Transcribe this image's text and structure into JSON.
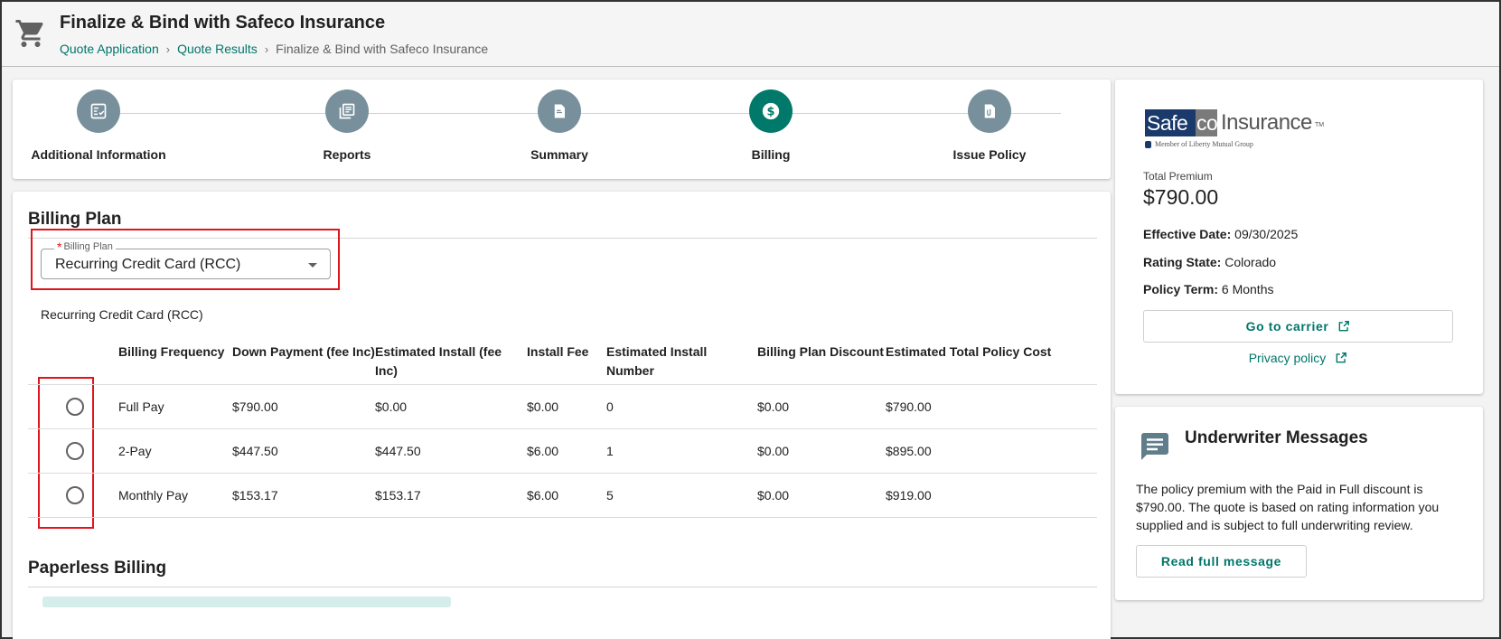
{
  "header": {
    "icon": "shopping-cart-icon",
    "title": "Finalize & Bind with Safeco Insurance",
    "breadcrumb": [
      "Quote Application",
      "Quote Results",
      "Finalize & Bind with Safeco Insurance"
    ]
  },
  "stepper": {
    "steps": [
      {
        "label": "Additional Information",
        "icon": "checklist-icon"
      },
      {
        "label": "Reports",
        "icon": "reports-icon"
      },
      {
        "label": "Summary",
        "icon": "document-icon"
      },
      {
        "label": "Billing",
        "icon": "dollar-icon"
      },
      {
        "label": "Issue Policy",
        "icon": "attachment-document-icon"
      }
    ],
    "active": "Billing"
  },
  "billing": {
    "section_title": "Billing Plan",
    "select_label": "Billing Plan",
    "select_value": "Recurring Credit Card (RCC)",
    "plan_subtitle": "Recurring Credit Card (RCC)",
    "columns": [
      "Billing Frequency",
      "Down Payment (fee Inc)",
      "Estimated Install (fee Inc)",
      "Install Fee",
      "Estimated Install Number",
      "Billing Plan Discount",
      "Estimated Total Policy Cost"
    ],
    "rows": [
      [
        "Full Pay",
        "$790.00",
        "$0.00",
        "$0.00",
        "0",
        "$0.00",
        "$790.00"
      ],
      [
        "2-Pay",
        "$447.50",
        "$447.50",
        "$6.00",
        "1",
        "$0.00",
        "$895.00"
      ],
      [
        "Monthly Pay",
        "$153.17",
        "$153.17",
        "$6.00",
        "5",
        "$0.00",
        "$919.00"
      ]
    ],
    "paperless_title": "Paperless Billing"
  },
  "carrier": {
    "logo_text_safe": "Safe",
    "logo_text_co": "co",
    "logo_text_insurance": "Insurance",
    "logo_tm": "TM",
    "logo_member": "Member of Liberty Mutual Group",
    "total_premium_label": "Total Premium",
    "total_premium_value": "$790.00",
    "effective_date_label": "Effective Date:",
    "effective_date_value": "09/30/2025",
    "rating_state_label": "Rating State:",
    "rating_state_value": "Colorado",
    "policy_term_label": "Policy Term:",
    "policy_term_value": "6 Months",
    "go_to_carrier": "Go to carrier",
    "privacy_policy": "Privacy policy"
  },
  "underwriter": {
    "title": "Underwriter Messages",
    "message": "The policy premium with the Paid in Full discount is $790.00. The quote is based on rating information you supplied and is subject to full underwriting review.",
    "read_button": "Read full message"
  },
  "colors": {
    "accent": "#00766a",
    "step_inactive": "#78909c",
    "step_active": "#00796b",
    "highlight": "#e0141c"
  }
}
